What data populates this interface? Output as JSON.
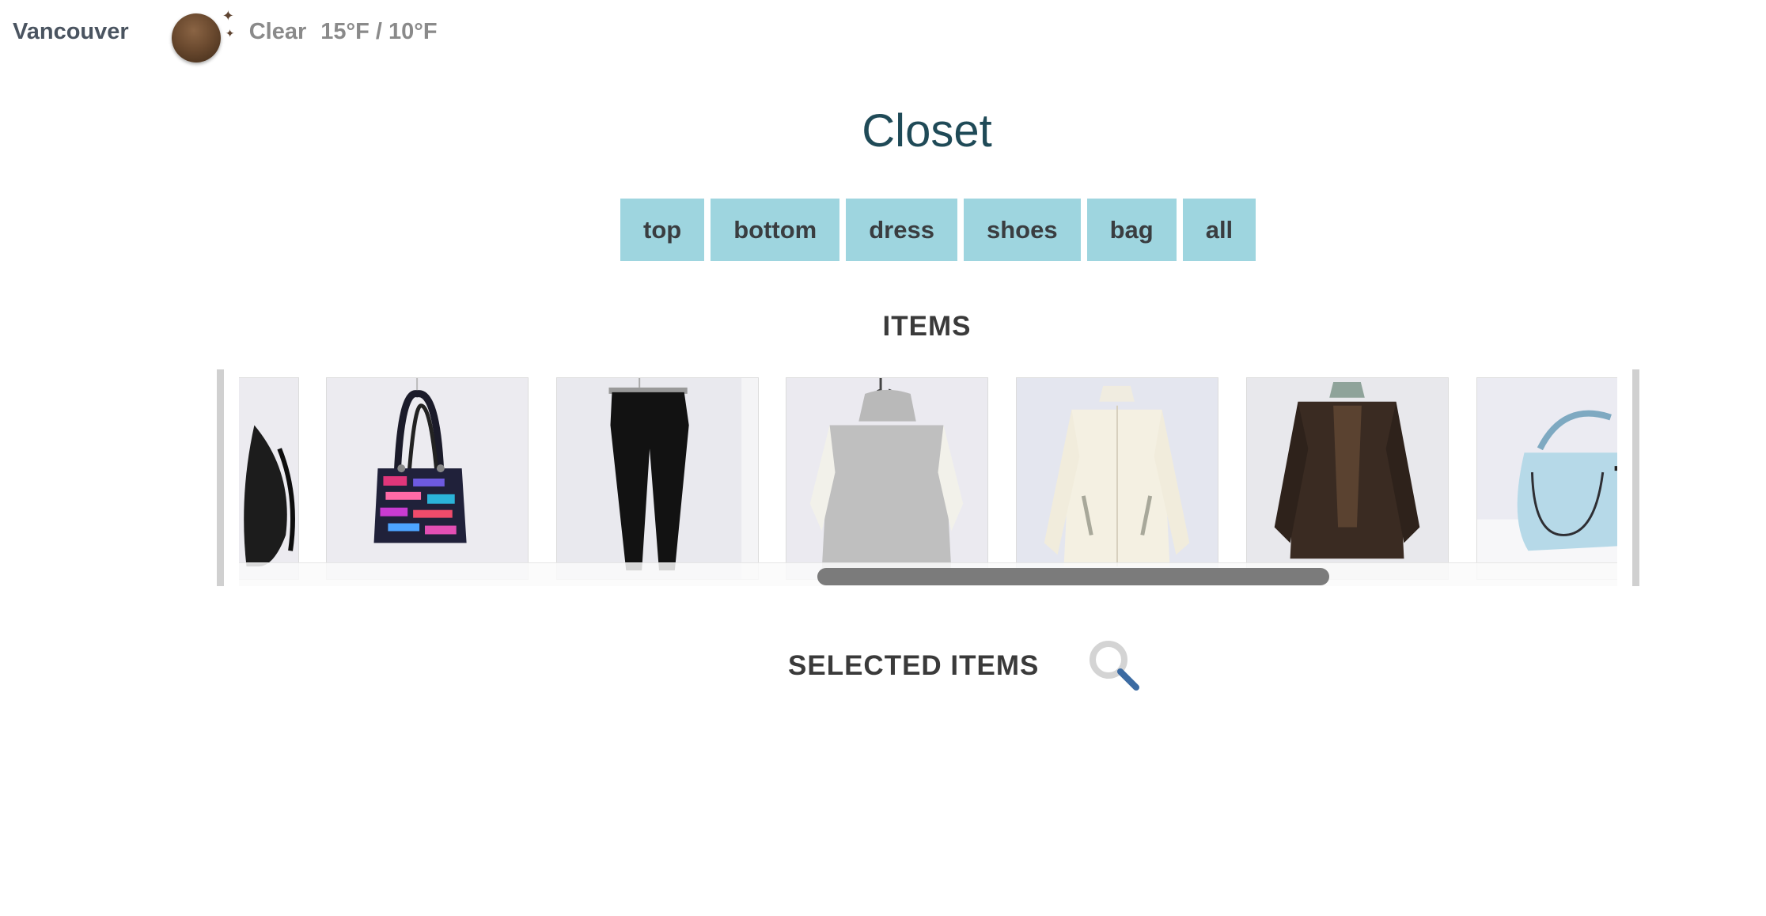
{
  "weather": {
    "city": "Vancouver",
    "icon": "moon-stars-icon",
    "condition": "Clear",
    "temps": "15°F / 10°F"
  },
  "title": "Closet",
  "categories": [
    "top",
    "bottom",
    "dress",
    "shoes",
    "bag",
    "all"
  ],
  "items_heading": "ITEMS",
  "items": [
    {
      "kind": "bag (partial)"
    },
    {
      "kind": "patterned tote bag"
    },
    {
      "kind": "black pants"
    },
    {
      "kind": "grey turtleneck sweater"
    },
    {
      "kind": "cream jacket"
    },
    {
      "kind": "brown leather jacket"
    },
    {
      "kind": "light blue handbag (partial)"
    }
  ],
  "selected_heading": "SELECTED ITEMS",
  "colors": {
    "accent_button": "#9ed5df",
    "title": "#1f4a57"
  }
}
